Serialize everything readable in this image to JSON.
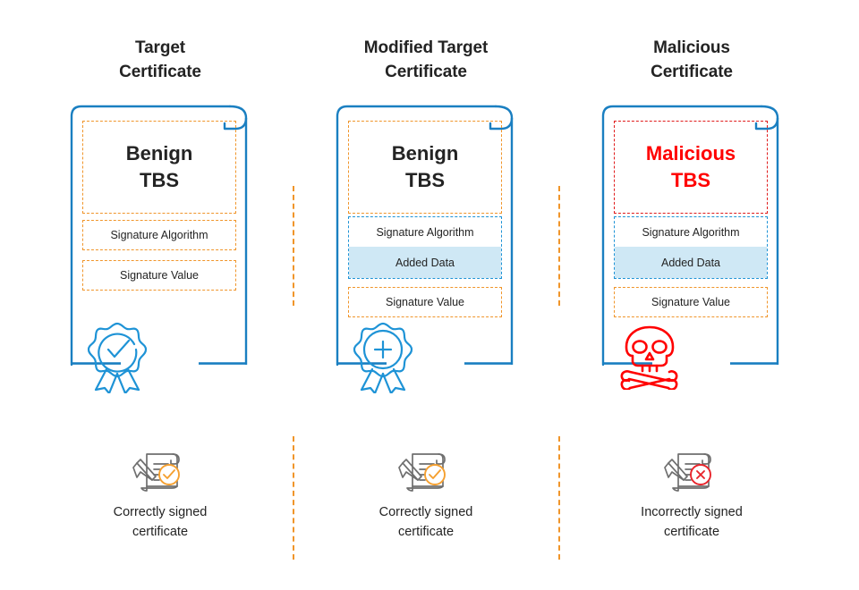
{
  "diagram": {
    "title": "Certificate signature forgery comparison",
    "colors": {
      "blue_frame": "#1a7fc1",
      "blue_dashed": "#1e93d6",
      "orange_dashed": "#f0952a",
      "red_dashed": "#e01b1b",
      "red_text": "#ff0000",
      "added_data_fill": "#cfe8f5",
      "gray_icon": "#6f6f6f",
      "text": "#232323"
    }
  },
  "columns": [
    {
      "id": "target",
      "title_line1": "Target",
      "title_line2": "Certificate",
      "tbs_line1": "Benign",
      "tbs_line2": "TBS",
      "tbs_variant": "benign",
      "has_added_data": false,
      "signature_algorithm_label": "Signature Algorithm",
      "signature_value_label": "Signature Value",
      "added_data_label": "",
      "seal_icon": "award-badge-check-icon",
      "seal_variant": "check",
      "status_icon": "signed-document-check-icon",
      "status_variant": "valid",
      "status_line1": "Correctly signed",
      "status_line2": "certificate"
    },
    {
      "id": "modified-target",
      "title_line1": "Modified Target",
      "title_line2": "Certificate",
      "tbs_line1": "Benign",
      "tbs_line2": "TBS",
      "tbs_variant": "benign",
      "has_added_data": true,
      "signature_algorithm_label": "Signature Algorithm",
      "signature_value_label": "Signature Value",
      "added_data_label": "Added Data",
      "seal_icon": "award-badge-plus-icon",
      "seal_variant": "plus",
      "status_icon": "signed-document-check-icon",
      "status_variant": "valid",
      "status_line1": "Correctly signed",
      "status_line2": "certificate"
    },
    {
      "id": "malicious",
      "title_line1": "Malicious",
      "title_line2": "Certificate",
      "tbs_line1": "Malicious",
      "tbs_line2": "TBS",
      "tbs_variant": "malicious",
      "has_added_data": true,
      "signature_algorithm_label": "Signature Algorithm",
      "signature_value_label": "Signature Value",
      "added_data_label": "Added Data",
      "seal_icon": "skull-crossbones-icon",
      "seal_variant": "skull",
      "status_icon": "signed-document-cross-icon",
      "status_variant": "invalid",
      "status_line1": "Incorrectly signed",
      "status_line2": "certificate"
    }
  ]
}
